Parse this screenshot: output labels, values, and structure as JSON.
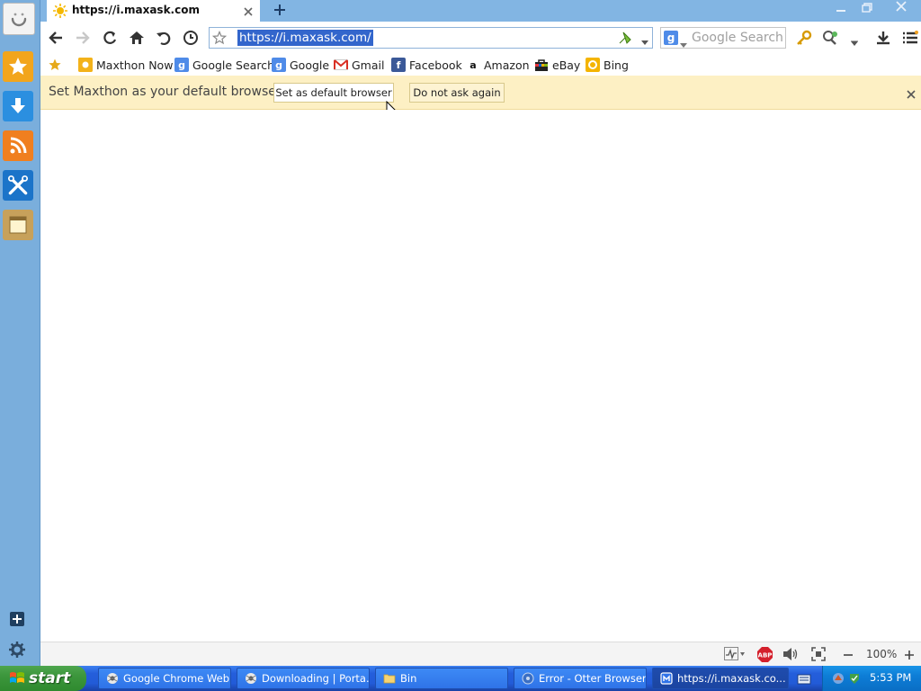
{
  "tab": {
    "title": "https://i.maxask.com"
  },
  "toolbar": {
    "address": "https://i.maxask.com/",
    "search_placeholder": "Google Search"
  },
  "bookmarks": [
    {
      "label": "Maxthon Now",
      "icon": "maxthon-now-icon"
    },
    {
      "label": "Google Search",
      "icon": "google-search-icon"
    },
    {
      "label": "Google",
      "icon": "google-icon"
    },
    {
      "label": "Gmail",
      "icon": "gmail-icon"
    },
    {
      "label": "Facebook",
      "icon": "facebook-icon"
    },
    {
      "label": "Amazon",
      "icon": "amazon-icon"
    },
    {
      "label": "eBay",
      "icon": "ebay-icon"
    },
    {
      "label": "Bing",
      "icon": "bing-icon"
    }
  ],
  "infobar": {
    "message": "Set Maxthon as your default browser?",
    "set_default_label": "Set as default browser",
    "do_not_ask_label": "Do not ask again"
  },
  "statusbar": {
    "zoom": "100%"
  },
  "taskbar": {
    "start_label": "start",
    "tasks": [
      {
        "label": "Google Chrome Web..."
      },
      {
        "label": "Downloading | Porta..."
      },
      {
        "label": "Bin"
      },
      {
        "label": "Error - Otter Browser"
      },
      {
        "label": "https://i.maxask.co..."
      }
    ],
    "clock": "5:53 PM"
  },
  "colors": {
    "sidebar": "#7aaedc",
    "tabstrip": "#82b5e3",
    "infobar": "#fdf0c4",
    "taskbar": "#245edb",
    "start_button": "#3c963c",
    "address_highlight": "#3366cc"
  }
}
